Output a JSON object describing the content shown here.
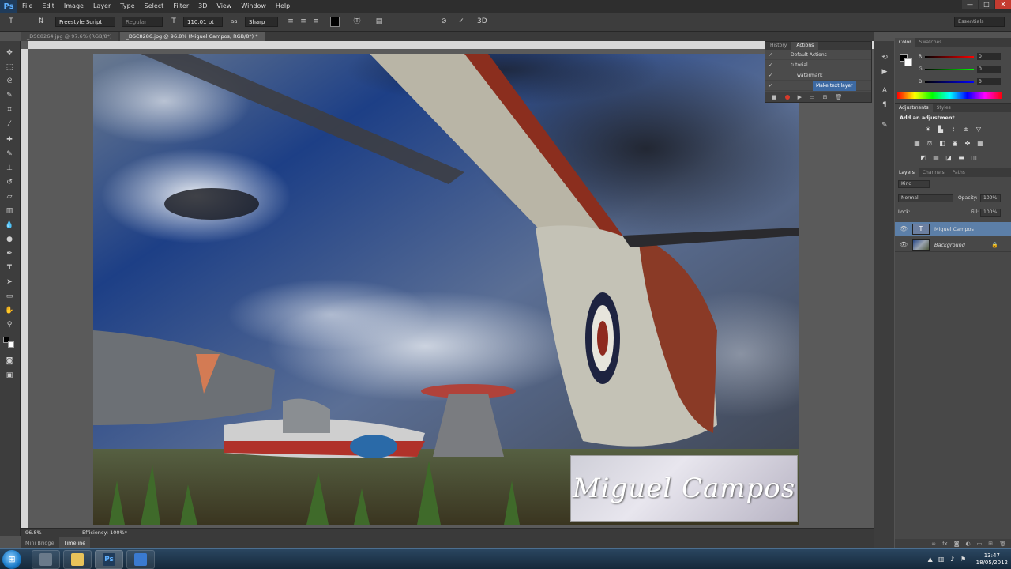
{
  "app": {
    "logo": "Ps"
  },
  "menu": [
    "File",
    "Edit",
    "Image",
    "Layer",
    "Type",
    "Select",
    "Filter",
    "3D",
    "View",
    "Window",
    "Help"
  ],
  "window_controls": {
    "minimize": "—",
    "maximize": "□",
    "close": "✕"
  },
  "options": {
    "font_family": "Freestyle Script",
    "font_style": "Regular",
    "font_size": "110.01 pt",
    "aa_label": "aa",
    "antialias": "Sharp",
    "workspace": "Essentials"
  },
  "tabs": [
    {
      "label": "_DSC8264.jpg @ 97.6% (RGB/8*)"
    },
    {
      "label": "_DSC8286.jpg @ 96.8% (Miguel Campos, RGB/8*) *"
    }
  ],
  "canvas": {
    "watermark_text": "Miguel Campos"
  },
  "status": {
    "zoom": "96.8%",
    "efficiency": "Efficiency: 100%*"
  },
  "bottom_tabs": [
    "Mini Bridge",
    "Timeline"
  ],
  "actions_panel": {
    "tabs": [
      "History",
      "Actions"
    ],
    "rows": [
      {
        "label": "Default Actions"
      },
      {
        "label": "tutorial"
      },
      {
        "label": "watermark"
      },
      {
        "label": "Make text layer"
      }
    ]
  },
  "color_panel": {
    "tabs": [
      "Color",
      "Swatches"
    ],
    "r_label": "R",
    "g_label": "G",
    "b_label": "B",
    "r": "0",
    "g": "0",
    "b": "0"
  },
  "adjustments_panel": {
    "tabs": [
      "Adjustments",
      "Styles"
    ],
    "heading": "Add an adjustment"
  },
  "layers_panel": {
    "tabs": [
      "Layers",
      "Channels",
      "Paths"
    ],
    "kind": "Kind",
    "blend_mode": "Normal",
    "opacity_label": "Opacity:",
    "opacity": "100%",
    "lock_label": "Lock:",
    "fill_label": "Fill:",
    "fill": "100%",
    "layers": [
      {
        "name": "Miguel Campos"
      },
      {
        "name": "Background"
      }
    ]
  },
  "taskbar": {
    "time": "13:47",
    "date": "18/05/2012",
    "ps_glyph": "Ps"
  },
  "colors": {
    "accent": "#3d6aa3",
    "bg": "#535353",
    "panel": "#484848"
  }
}
